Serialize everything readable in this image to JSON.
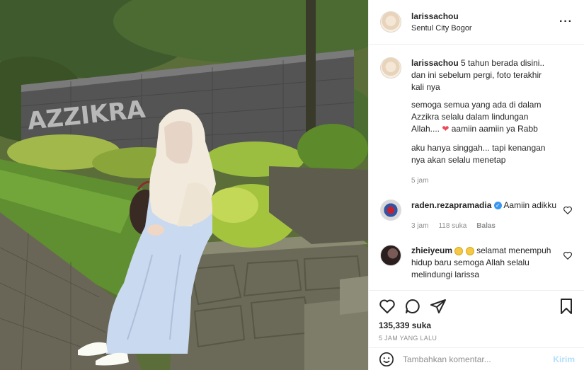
{
  "header": {
    "username": "larissachou",
    "location": "Sentul City Bogor",
    "more_icon": "more-options-icon"
  },
  "caption": {
    "username": "larissachou",
    "lines": [
      "5 tahun berada disini..",
      "dan ini sebelum pergi, foto terakhir",
      "kali nya",
      "semoga semua yang ada di dalam",
      "Azzikra selalu dalam lindungan",
      "Allah.... ",
      " aamiin aamiin ya Rabb",
      "aku hanya singgah... tapi kenangan",
      "nya akan selalu menetap"
    ],
    "time": "5 jam"
  },
  "comments": [
    {
      "username": "raden.rezapramadia",
      "text": "Aamiin adikku",
      "time": "3 jam",
      "likes": "118 suka",
      "reply": "Balas"
    },
    {
      "username": "zhieiyeum",
      "text_pre": "",
      "text_after_emoji": "selamat menempuh hidup baru semoga Allah selalu melindungi larissa"
    }
  ],
  "actions": {
    "likes": "135,339 suka",
    "time_ago": "5 JAM YANG LALU"
  },
  "add_comment": {
    "placeholder": "Tambahkan komentar...",
    "post_label": "Kirim"
  },
  "photo": {
    "sign_text": "AZZIKRA"
  },
  "colors": {
    "verified": "#3897f0",
    "heart": "#ed4956",
    "post_button": "#b2dffc",
    "secondary_text": "#8e8e8e"
  }
}
